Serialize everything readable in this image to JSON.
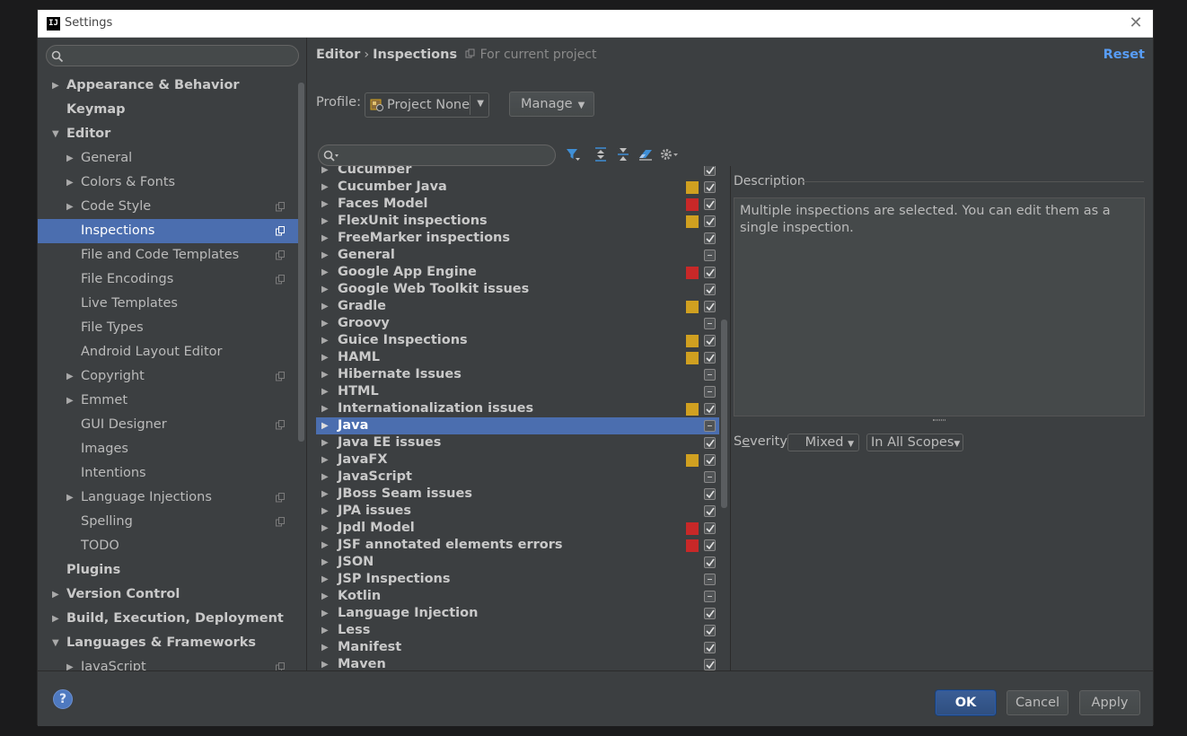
{
  "window": {
    "title": "Settings",
    "logo_text": "IJ",
    "close_glyph": "✕"
  },
  "sidebar": {
    "search_icon": "search-icon",
    "items": [
      {
        "label": "Appearance & Behavior",
        "level": 0,
        "arrow": "▶",
        "bold": true,
        "copy": false,
        "selected": false
      },
      {
        "label": "Keymap",
        "level": 0,
        "arrow": "",
        "bold": true,
        "copy": false,
        "selected": false
      },
      {
        "label": "Editor",
        "level": 0,
        "arrow": "▼",
        "bold": true,
        "copy": false,
        "selected": false
      },
      {
        "label": "General",
        "level": 1,
        "arrow": "▶",
        "bold": false,
        "copy": false,
        "selected": false
      },
      {
        "label": "Colors & Fonts",
        "level": 1,
        "arrow": "▶",
        "bold": false,
        "copy": false,
        "selected": false
      },
      {
        "label": "Code Style",
        "level": 1,
        "arrow": "▶",
        "bold": false,
        "copy": true,
        "selected": false
      },
      {
        "label": "Inspections",
        "level": 1,
        "arrow": "",
        "bold": false,
        "copy": true,
        "selected": true
      },
      {
        "label": "File and Code Templates",
        "level": 1,
        "arrow": "",
        "bold": false,
        "copy": true,
        "selected": false
      },
      {
        "label": "File Encodings",
        "level": 1,
        "arrow": "",
        "bold": false,
        "copy": true,
        "selected": false
      },
      {
        "label": "Live Templates",
        "level": 1,
        "arrow": "",
        "bold": false,
        "copy": false,
        "selected": false
      },
      {
        "label": "File Types",
        "level": 1,
        "arrow": "",
        "bold": false,
        "copy": false,
        "selected": false
      },
      {
        "label": "Android Layout Editor",
        "level": 1,
        "arrow": "",
        "bold": false,
        "copy": false,
        "selected": false
      },
      {
        "label": "Copyright",
        "level": 1,
        "arrow": "▶",
        "bold": false,
        "copy": true,
        "selected": false
      },
      {
        "label": "Emmet",
        "level": 1,
        "arrow": "▶",
        "bold": false,
        "copy": false,
        "selected": false
      },
      {
        "label": "GUI Designer",
        "level": 1,
        "arrow": "",
        "bold": false,
        "copy": true,
        "selected": false
      },
      {
        "label": "Images",
        "level": 1,
        "arrow": "",
        "bold": false,
        "copy": false,
        "selected": false
      },
      {
        "label": "Intentions",
        "level": 1,
        "arrow": "",
        "bold": false,
        "copy": false,
        "selected": false
      },
      {
        "label": "Language Injections",
        "level": 1,
        "arrow": "▶",
        "bold": false,
        "copy": true,
        "selected": false
      },
      {
        "label": "Spelling",
        "level": 1,
        "arrow": "",
        "bold": false,
        "copy": true,
        "selected": false
      },
      {
        "label": "TODO",
        "level": 1,
        "arrow": "",
        "bold": false,
        "copy": false,
        "selected": false
      },
      {
        "label": "Plugins",
        "level": 0,
        "arrow": "",
        "bold": true,
        "copy": false,
        "selected": false
      },
      {
        "label": "Version Control",
        "level": 0,
        "arrow": "▶",
        "bold": true,
        "copy": false,
        "selected": false
      },
      {
        "label": "Build, Execution, Deployment",
        "level": 0,
        "arrow": "▶",
        "bold": true,
        "copy": false,
        "selected": false
      },
      {
        "label": "Languages & Frameworks",
        "level": 0,
        "arrow": "▼",
        "bold": true,
        "copy": false,
        "selected": false
      },
      {
        "label": "JavaScript",
        "level": 1,
        "arrow": "▶",
        "bold": false,
        "copy": true,
        "selected": false
      }
    ]
  },
  "header": {
    "crumb_parent": "Editor",
    "crumb_sep": "›",
    "crumb_current": "Inspections",
    "scope_text": "For current project",
    "reset_label": "Reset"
  },
  "profile": {
    "label": "Profile:",
    "value": "Project None",
    "dropdown_glyph": "▼",
    "manage_label": "Manage",
    "manage_glyph": "▼"
  },
  "toolbar": {
    "icons": [
      "filter-icon",
      "expand-all-icon",
      "collapse-all-icon",
      "eraser-icon",
      "gear-icon"
    ]
  },
  "colors": {
    "selection": "#4b6eaf",
    "warning": "#d0a020",
    "error": "#c82828",
    "link": "#589df6"
  },
  "inspections": [
    {
      "name": "Cucumber",
      "severity": "none",
      "state": "checked",
      "selected": false
    },
    {
      "name": "Cucumber Java",
      "severity": "warning",
      "state": "checked",
      "selected": false
    },
    {
      "name": "Faces Model",
      "severity": "error",
      "state": "checked",
      "selected": false
    },
    {
      "name": "FlexUnit inspections",
      "severity": "warning",
      "state": "checked",
      "selected": false
    },
    {
      "name": "FreeMarker inspections",
      "severity": "none",
      "state": "checked",
      "selected": false
    },
    {
      "name": "General",
      "severity": "none",
      "state": "mixed",
      "selected": false
    },
    {
      "name": "Google App Engine",
      "severity": "error",
      "state": "checked",
      "selected": false
    },
    {
      "name": "Google Web Toolkit issues",
      "severity": "none",
      "state": "checked",
      "selected": false
    },
    {
      "name": "Gradle",
      "severity": "warning",
      "state": "checked",
      "selected": false
    },
    {
      "name": "Groovy",
      "severity": "none",
      "state": "mixed",
      "selected": false
    },
    {
      "name": "Guice Inspections",
      "severity": "warning",
      "state": "checked",
      "selected": false
    },
    {
      "name": "HAML",
      "severity": "warning",
      "state": "checked",
      "selected": false
    },
    {
      "name": "Hibernate Issues",
      "severity": "none",
      "state": "mixed",
      "selected": false
    },
    {
      "name": "HTML",
      "severity": "none",
      "state": "mixed",
      "selected": false
    },
    {
      "name": "Internationalization issues",
      "severity": "warning",
      "state": "checked",
      "selected": false
    },
    {
      "name": "Java",
      "severity": "none",
      "state": "mixed",
      "selected": true
    },
    {
      "name": "Java EE issues",
      "severity": "none",
      "state": "checked",
      "selected": false
    },
    {
      "name": "JavaFX",
      "severity": "warning",
      "state": "checked",
      "selected": false
    },
    {
      "name": "JavaScript",
      "severity": "none",
      "state": "mixed",
      "selected": false
    },
    {
      "name": "JBoss Seam issues",
      "severity": "none",
      "state": "checked",
      "selected": false
    },
    {
      "name": "JPA issues",
      "severity": "none",
      "state": "checked",
      "selected": false
    },
    {
      "name": "Jpdl Model",
      "severity": "error",
      "state": "checked",
      "selected": false
    },
    {
      "name": "JSF annotated elements errors",
      "severity": "error",
      "state": "checked",
      "selected": false
    },
    {
      "name": "JSON",
      "severity": "none",
      "state": "checked",
      "selected": false
    },
    {
      "name": "JSP Inspections",
      "severity": "none",
      "state": "mixed",
      "selected": false
    },
    {
      "name": "Kotlin",
      "severity": "none",
      "state": "mixed",
      "selected": false
    },
    {
      "name": "Language Injection",
      "severity": "none",
      "state": "checked",
      "selected": false
    },
    {
      "name": "Less",
      "severity": "none",
      "state": "checked",
      "selected": false
    },
    {
      "name": "Manifest",
      "severity": "none",
      "state": "checked",
      "selected": false
    },
    {
      "name": "Maven",
      "severity": "none",
      "state": "checked",
      "selected": false
    }
  ],
  "description": {
    "label": "Description",
    "text": "Multiple inspections are selected. You can edit them as a single inspection."
  },
  "severity": {
    "label": "Severity:",
    "value": "Mixed",
    "scope_value": "In All Scopes",
    "dropdown_glyph": "▼"
  },
  "footer": {
    "help_glyph": "?",
    "ok_label": "OK",
    "cancel_label": "Cancel",
    "apply_label": "Apply"
  }
}
